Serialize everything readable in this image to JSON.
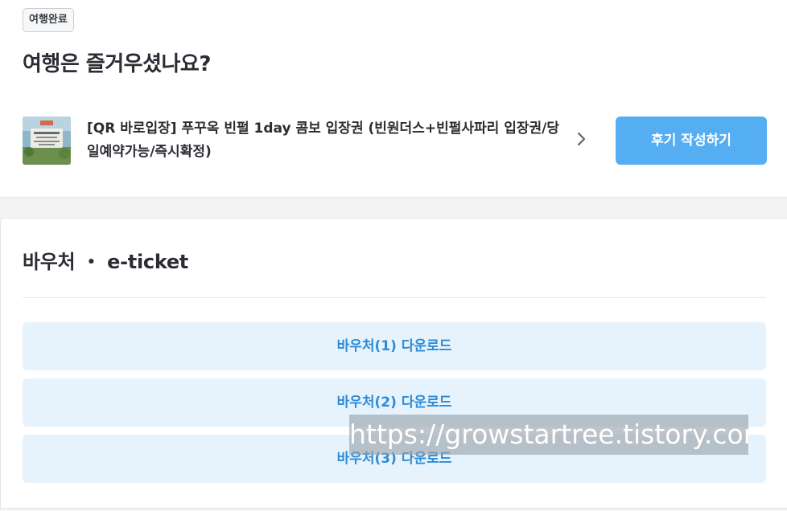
{
  "status": {
    "badge": "여행완료"
  },
  "headline": "여행은 즐거우셨나요?",
  "product": {
    "title": "[QR 바로입장] 푸꾸옥 빈펄 1day 콤보 입장권 (빈원더스+빈펄사파리 입장권/당일예약가능/즉시확정)",
    "thumbnail_icon": "product-thumbnail",
    "chevron_icon": "chevron-right-icon"
  },
  "review": {
    "button_label": "후기 작성하기",
    "button_color": "#56aef2"
  },
  "voucher": {
    "section_title": "바우처 ・ e-ticket",
    "downloads": [
      {
        "label": "바우처(1) 다운로드"
      },
      {
        "label": "바우처(2) 다운로드"
      },
      {
        "label": "바우처(3) 다운로드"
      }
    ],
    "button_bg": "#e6f3fd",
    "button_text_color": "#2d8bd6"
  },
  "watermark": {
    "text": "https://growstartree.tistory.com"
  }
}
